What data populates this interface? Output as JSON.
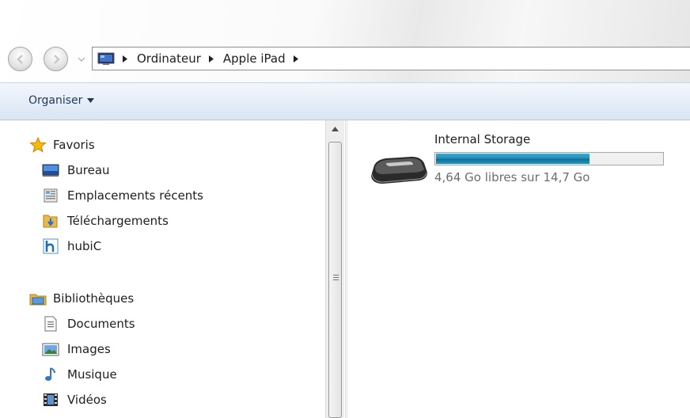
{
  "address_bar": {
    "breadcrumbs": [
      "Ordinateur",
      "Apple iPad"
    ]
  },
  "toolbar": {
    "organize_label": "Organiser"
  },
  "navigation": {
    "favorites": {
      "label": "Favoris",
      "items": [
        {
          "label": "Bureau",
          "icon": "desktop-icon"
        },
        {
          "label": "Emplacements récents",
          "icon": "recent-places-icon"
        },
        {
          "label": "Téléchargements",
          "icon": "downloads-icon"
        },
        {
          "label": "hubiC",
          "icon": "hubic-icon"
        }
      ]
    },
    "libraries": {
      "label": "Bibliothèques",
      "items": [
        {
          "label": "Documents",
          "icon": "documents-icon"
        },
        {
          "label": "Images",
          "icon": "images-icon"
        },
        {
          "label": "Musique",
          "icon": "music-icon"
        },
        {
          "label": "Vidéos",
          "icon": "videos-icon"
        }
      ]
    }
  },
  "content": {
    "drive": {
      "name": "Internal Storage",
      "free_text": "4,64 Go libres sur 14,7 Go",
      "used_fraction": 0.68,
      "bar_color": "#1b86b0"
    }
  }
}
